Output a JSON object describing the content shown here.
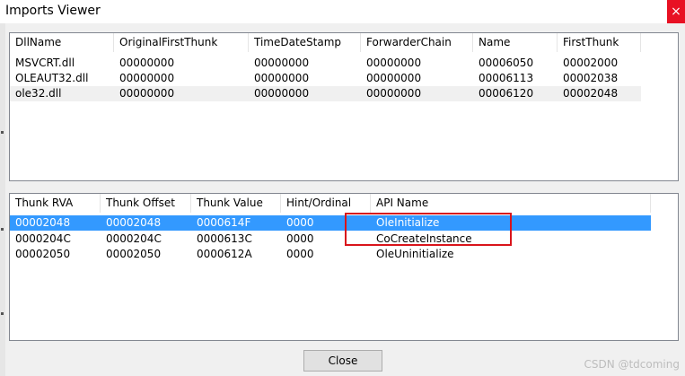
{
  "window": {
    "title": "Imports Viewer",
    "close_glyph": "×"
  },
  "dll_list": {
    "columns": [
      "DllName",
      "OriginalFirstThunk",
      "TimeDateStamp",
      "ForwarderChain",
      "Name",
      "FirstThunk"
    ],
    "rows": [
      [
        "MSVCRT.dll",
        "00000000",
        "00000000",
        "00000000",
        "00006050",
        "00002000"
      ],
      [
        "OLEAUT32.dll",
        "00000000",
        "00000000",
        "00000000",
        "00006113",
        "00002038"
      ],
      [
        "ole32.dll",
        "00000000",
        "00000000",
        "00000000",
        "00006120",
        "00002048"
      ]
    ],
    "selected_row": 2
  },
  "thunk_list": {
    "columns": [
      "Thunk RVA",
      "Thunk Offset",
      "Thunk Value",
      "Hint/Ordinal",
      "API Name"
    ],
    "rows": [
      [
        "00002048",
        "00002048",
        "0000614F",
        "0000",
        "OleInitialize"
      ],
      [
        "0000204C",
        "0000204C",
        "0000613C",
        "0000",
        "CoCreateInstance"
      ],
      [
        "00002050",
        "00002050",
        "0000612A",
        "0000",
        "OleUninitialize"
      ]
    ],
    "selected_row": 0
  },
  "buttons": {
    "close_label": "Close"
  },
  "watermark": "CSDN @tdcoming",
  "colors": {
    "selection": "#3399ff",
    "highlight_box": "#d9141b",
    "close_button_bg": "#e81123"
  }
}
